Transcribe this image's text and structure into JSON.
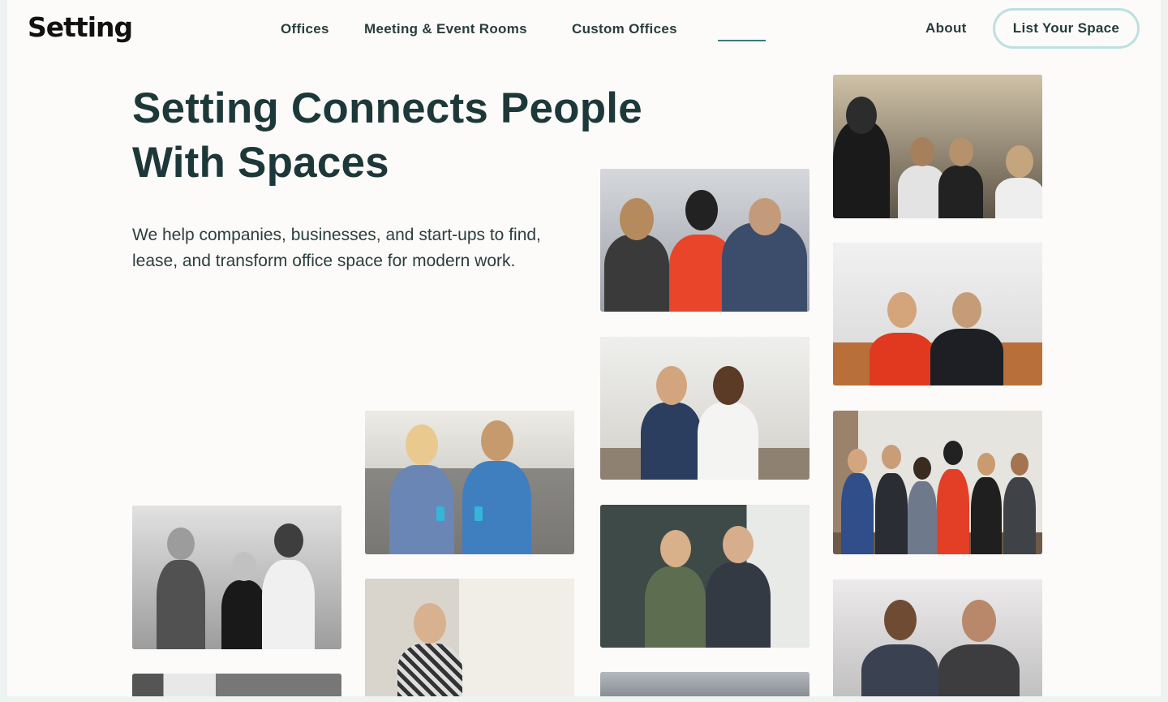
{
  "brand": {
    "logo": "Setting"
  },
  "nav": {
    "links": [
      "Offices",
      "Meeting & Event Rooms",
      "Custom Offices"
    ],
    "about": "About",
    "cta": "List Your Space"
  },
  "hero": {
    "title_line1": "Setting Connects People",
    "title_line2": "With Spaces",
    "description": "We help companies, businesses, and start-ups to find, lease, and transform office space for modern work."
  },
  "colors": {
    "background": "#fcfbf9",
    "heading": "#1d3839",
    "cta_border": "#bde0e2",
    "nav_underline": "#3b7b7b"
  }
}
